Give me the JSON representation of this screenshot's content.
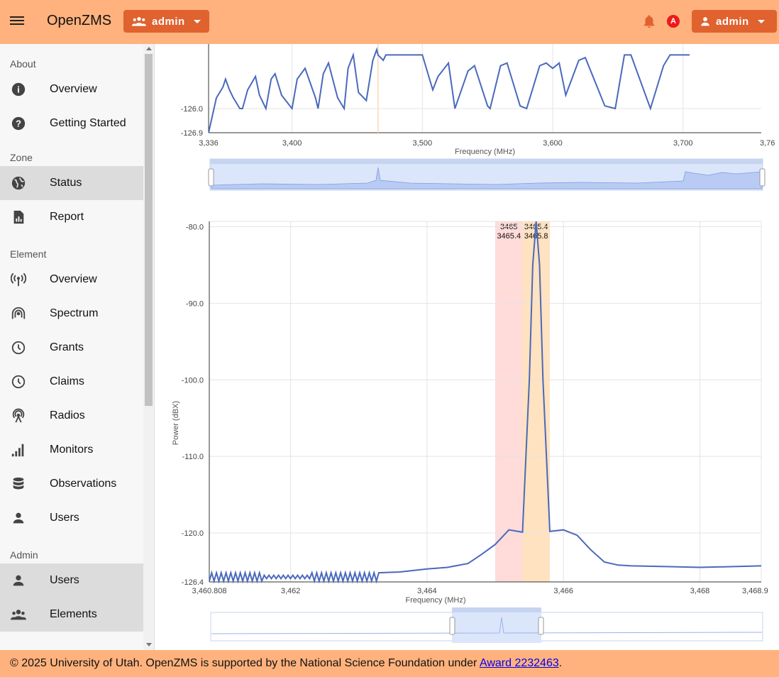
{
  "header": {
    "app_title": "OpenZMS",
    "element_menu_label": "admin",
    "user_menu_label": "admin",
    "alert_badge": "A"
  },
  "sidebar": {
    "sections": [
      {
        "title": "About",
        "items": [
          {
            "label": "Overview",
            "icon": "info-icon",
            "active": false
          },
          {
            "label": "Getting Started",
            "icon": "help-icon",
            "active": false
          }
        ]
      },
      {
        "title": "Zone",
        "items": [
          {
            "label": "Status",
            "icon": "globe-icon",
            "active": true
          },
          {
            "label": "Report",
            "icon": "report-icon",
            "active": false
          }
        ]
      },
      {
        "title": "Element",
        "items": [
          {
            "label": "Overview",
            "icon": "antenna-icon",
            "active": false
          },
          {
            "label": "Spectrum",
            "icon": "spectrum-icon",
            "active": false
          },
          {
            "label": "Grants",
            "icon": "clock-icon",
            "active": false
          },
          {
            "label": "Claims",
            "icon": "clock-icon",
            "active": false
          },
          {
            "label": "Radios",
            "icon": "radio-icon",
            "active": false
          },
          {
            "label": "Monitors",
            "icon": "signal-bars-icon",
            "active": false
          },
          {
            "label": "Observations",
            "icon": "database-icon",
            "active": false
          },
          {
            "label": "Users",
            "icon": "person-icon",
            "active": false
          }
        ]
      },
      {
        "title": "Admin",
        "items": [
          {
            "label": "Users",
            "icon": "person-icon",
            "active": true
          },
          {
            "label": "Elements",
            "icon": "group-icon",
            "active": true
          }
        ]
      }
    ]
  },
  "chart_data": [
    {
      "type": "line",
      "xlabel": "Frequency (MHz)",
      "ylabel": "",
      "xlim": [
        3336,
        3760
      ],
      "x_ticks": [
        "3,336",
        "3,400",
        "3,500",
        "3,600",
        "3,700",
        "3,76"
      ],
      "y_ticks": [
        "-126.0",
        "-126.9"
      ],
      "marker_line_x": 3466,
      "series_color": "#4a69bd",
      "note_visible_part": "upper portion of spectrum chart scrolled out of view",
      "x": [
        3336,
        3342,
        3347,
        3349,
        3352,
        3355,
        3360,
        3362,
        3366,
        3372,
        3375,
        3380,
        3384,
        3387,
        3392,
        3400,
        3404,
        3410,
        3418,
        3420,
        3424,
        3428,
        3435,
        3440,
        3443,
        3447,
        3451,
        3457,
        3462,
        3465,
        3466,
        3470,
        3472,
        3500,
        3508,
        3512,
        3520,
        3525,
        3535,
        3540,
        3550,
        3552,
        3560,
        3565,
        3575,
        3580,
        3590,
        3595,
        3600,
        3605,
        3610,
        3620,
        3625,
        3640,
        3648,
        3655,
        3660,
        3675,
        3685,
        3690,
        3700,
        3705
      ],
      "y": [
        -126.9,
        -125.6,
        -125.2,
        -124.9,
        -125.3,
        -125.6,
        -126.0,
        -126.0,
        -125.3,
        -124.8,
        -125.5,
        -126.0,
        -124.9,
        -124.7,
        -125.5,
        -126.0,
        -124.9,
        -124.5,
        -125.6,
        -126.0,
        -124.7,
        -124.3,
        -125.6,
        -126.0,
        -124.5,
        -124.0,
        -125.4,
        -125.7,
        -124.2,
        -123.8,
        -124.0,
        -124.2,
        -124.0,
        -124.0,
        -125.3,
        -124.8,
        -124.3,
        -126.0,
        -124.6,
        -124.4,
        -125.9,
        -126.0,
        -124.4,
        -124.3,
        -125.9,
        -126.0,
        -124.4,
        -124.3,
        -124.5,
        -124.3,
        -125.5,
        -124.2,
        -124.1,
        -125.9,
        -126.0,
        -124.0,
        -124.0,
        -126.0,
        -124.4,
        -124.0,
        -124.0,
        -124.0
      ]
    },
    {
      "type": "line",
      "xlabel": "Frequency (MHz)",
      "ylabel": "Power (dBX)",
      "xlim": [
        3460.808,
        3468.9
      ],
      "ylim": [
        -126.4,
        -79.3
      ],
      "x_ticks": [
        "3,460.808",
        "3,462",
        "3,464",
        "3,466",
        "3,468",
        "3,468.9"
      ],
      "y_ticks": [
        "-80.0",
        "-90.0",
        "-100.0",
        "-110.0",
        "-120.0",
        "-126.4"
      ],
      "series_color": "#4a69bd",
      "bands": [
        {
          "from": 3465.0,
          "to": 3465.4,
          "color": "#ffdbd9",
          "label_top": "3465",
          "label_bottom": "3465.4"
        },
        {
          "from": 3465.4,
          "to": 3465.8,
          "color": "#ffe2bf",
          "label_top": "3465.4",
          "label_bottom": "3465.8"
        }
      ],
      "x": [
        3460.808,
        3461.0,
        3461.3,
        3461.6,
        3462.0,
        3462.4,
        3462.8,
        3463.3,
        3463.6,
        3464.0,
        3464.3,
        3464.6,
        3464.8,
        3465.0,
        3465.2,
        3465.4,
        3465.5,
        3465.55,
        3465.6,
        3465.65,
        3465.7,
        3465.8,
        3466.0,
        3466.2,
        3466.4,
        3466.6,
        3466.8,
        3467.0,
        3467.5,
        3468.0,
        3468.5,
        3468.9
      ],
      "y": [
        -125.7,
        -125.8,
        -125.7,
        -125.8,
        -125.7,
        -125.6,
        -125.7,
        -125.7,
        -125.1,
        -124.7,
        -124.5,
        -124.0,
        -122.8,
        -121.5,
        -119.6,
        -119.9,
        -100.0,
        -85.0,
        -79.3,
        -85.0,
        -100.0,
        -119.8,
        -119.6,
        -120.3,
        -122.2,
        -123.8,
        -124.2,
        -124.3,
        -124.4,
        -124.5,
        -124.4,
        -124.3
      ]
    }
  ],
  "footer": {
    "text": "© 2025 University of Utah. OpenZMS is supported by the National Science Foundation under ",
    "link_text": "Award 2232463",
    "suffix": "."
  }
}
